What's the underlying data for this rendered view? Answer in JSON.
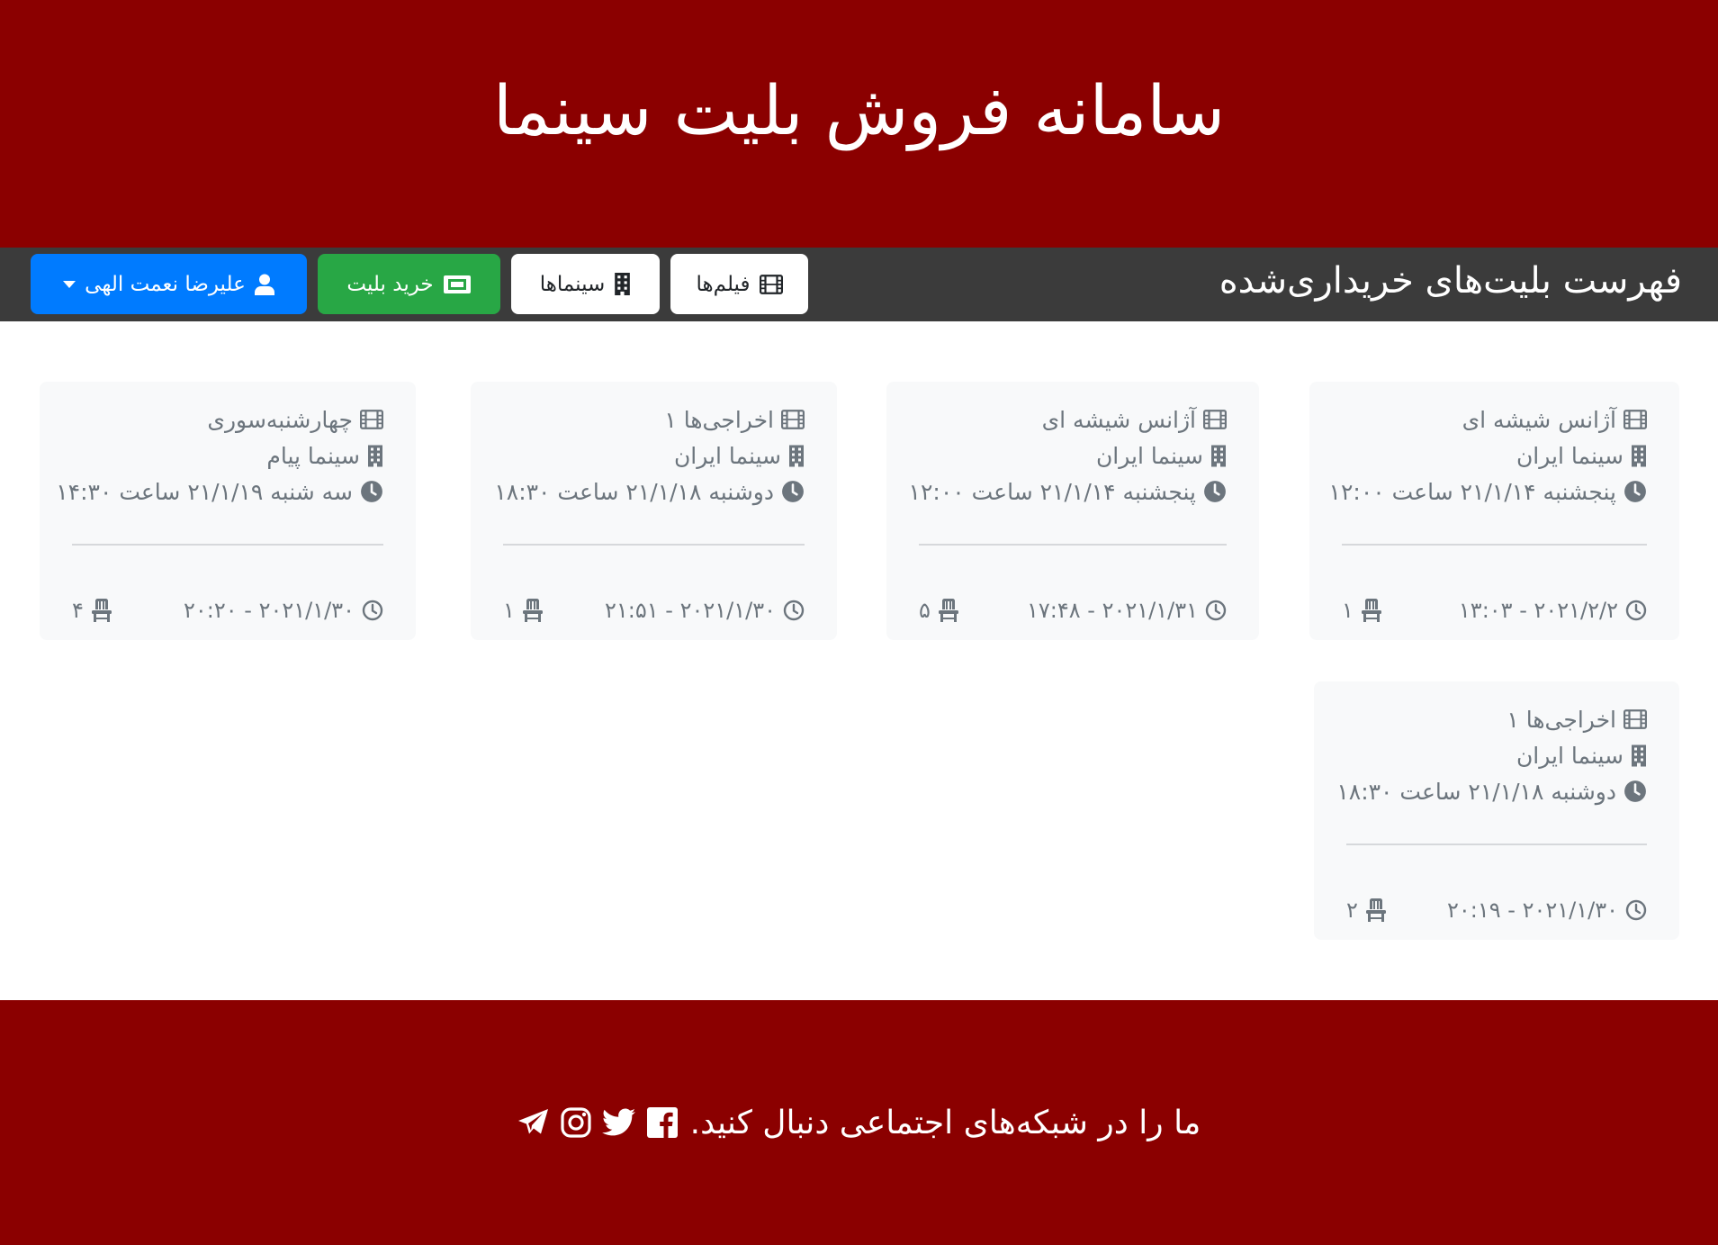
{
  "header": {
    "title": "سامانه فروش بلیت سینما"
  },
  "navbar": {
    "page_title": "فهرست بلیت‌های خریداری‌شده",
    "films_label": "فیلم‌ها",
    "cinemas_label": "سینماها",
    "buy_label": "خرید بلیت",
    "user_label": "علیرضا نعمت الهی"
  },
  "tickets": [
    {
      "film": "آژانس شیشه ای",
      "cinema": "سینما ایران",
      "showtime": "پنجشنبه ۲۱/۱/۱۴ ساعت ۱۲:۰۰",
      "purchased": "۲۰۲۱/۲/۲ - ۱۳:۰۳",
      "seats": "۱"
    },
    {
      "film": "آژانس شیشه ای",
      "cinema": "سینما ایران",
      "showtime": "پنجشنبه ۲۱/۱/۱۴ ساعت ۱۲:۰۰",
      "purchased": "۲۰۲۱/۱/۳۱ - ۱۷:۴۸",
      "seats": "۵"
    },
    {
      "film": "اخراجی‌ها ۱",
      "cinema": "سینما ایران",
      "showtime": "دوشنبه ۲۱/۱/۱۸ ساعت ۱۸:۳۰",
      "purchased": "۲۰۲۱/۱/۳۰ - ۲۱:۵۱",
      "seats": "۱"
    },
    {
      "film": "چهارشنبه‌سوری",
      "cinema": "سینما پیام",
      "showtime": "سه شنبه ۲۱/۱/۱۹ ساعت ۱۴:۳۰",
      "purchased": "۲۰۲۱/۱/۳۰ - ۲۰:۲۰",
      "seats": "۴"
    },
    {
      "film": "اخراجی‌ها ۱",
      "cinema": "سینما ایران",
      "showtime": "دوشنبه ۲۱/۱/۱۸ ساعت ۱۸:۳۰",
      "purchased": "۲۰۲۱/۱/۳۰ - ۲۰:۱۹",
      "seats": "۲"
    }
  ],
  "footer": {
    "text": "ما را در شبکه‌های اجتماعی دنبال کنید.",
    "social_icons": [
      "facebook-icon",
      "twitter-icon",
      "instagram-icon",
      "telegram-icon"
    ]
  },
  "colors": {
    "header_bg": "#8b0000",
    "navbar_bg": "#3b3b3b",
    "buy_button": "#28a745",
    "user_button": "#007bff",
    "card_bg": "#f8f9fa",
    "card_text": "#6c757d"
  }
}
